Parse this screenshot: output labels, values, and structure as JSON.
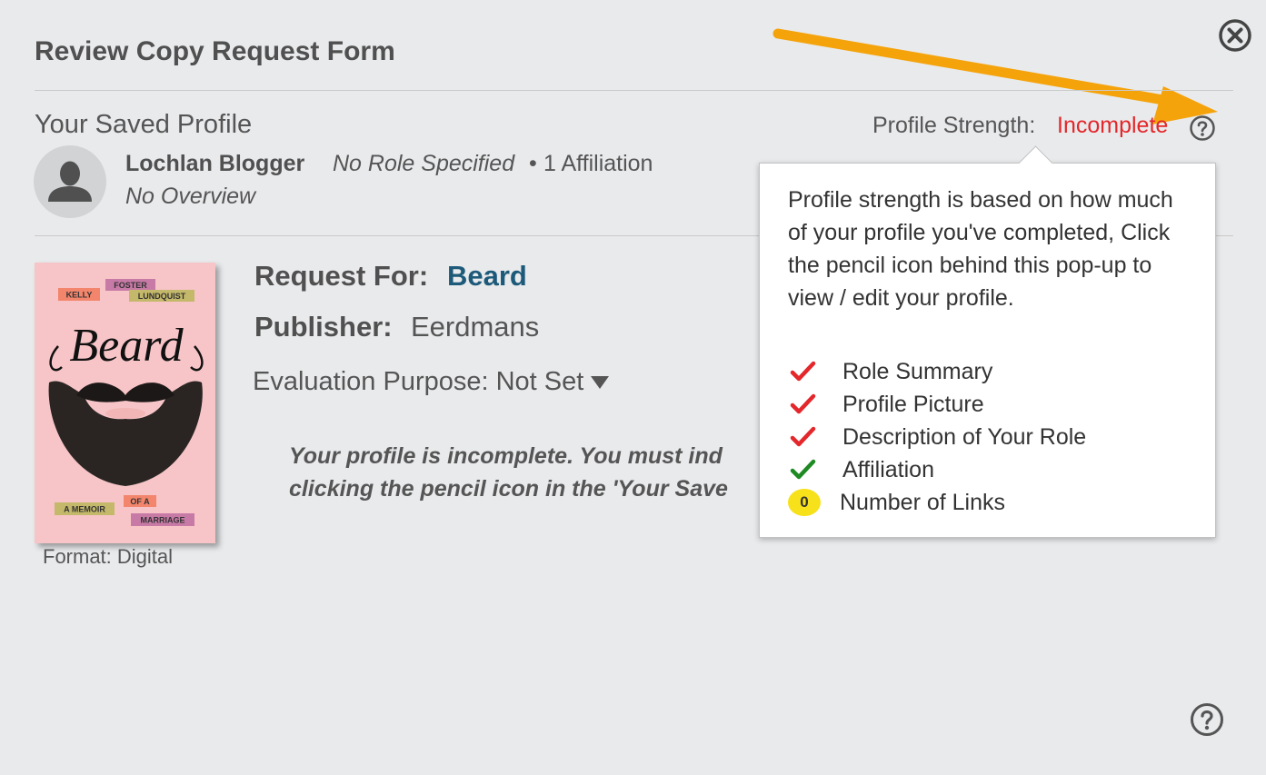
{
  "form": {
    "title": "Review Copy Request Form"
  },
  "profile": {
    "section_title": "Your Saved Profile",
    "name": "Lochlan Blogger",
    "role": "No Role Specified",
    "separator": "•",
    "affiliations": "1 Affiliation",
    "overview": "No Overview",
    "strength_label": "Profile Strength:",
    "strength_value": "Incomplete"
  },
  "request": {
    "for_label": "Request For:",
    "title": "Beard",
    "publisher_label": "Publisher:",
    "publisher": "Eerdmans",
    "evaluation_label": "Evaluation Purpose:",
    "evaluation_value": "Not Set",
    "format": "Format: Digital",
    "incomplete_line1": "Your profile is incomplete. You must ind",
    "incomplete_line2": "clicking the pencil icon in the 'Your Save"
  },
  "cover": {
    "author_first": "KELLY",
    "author_mid": "FOSTER",
    "author_last": "LUNDQUIST",
    "title": "Beard",
    "tag1": "A MEMOIR",
    "tag2": "OF A",
    "tag3": "MARRIAGE"
  },
  "popup": {
    "text": "Profile strength is based on how much of your profile you've completed, Click the pencil icon behind this pop-up to view / edit your profile.",
    "items": [
      {
        "label": "Role Summary",
        "status": "incomplete"
      },
      {
        "label": "Profile Picture",
        "status": "incomplete"
      },
      {
        "label": "Description of Your Role",
        "status": "incomplete"
      },
      {
        "label": "Affiliation",
        "status": "complete"
      },
      {
        "label": "Number of Links",
        "count": "0"
      }
    ]
  },
  "colors": {
    "incomplete": "#e3272b",
    "complete": "#1e8a23",
    "link": "#1d5a7a",
    "annotation_arrow": "#f5a30b"
  }
}
